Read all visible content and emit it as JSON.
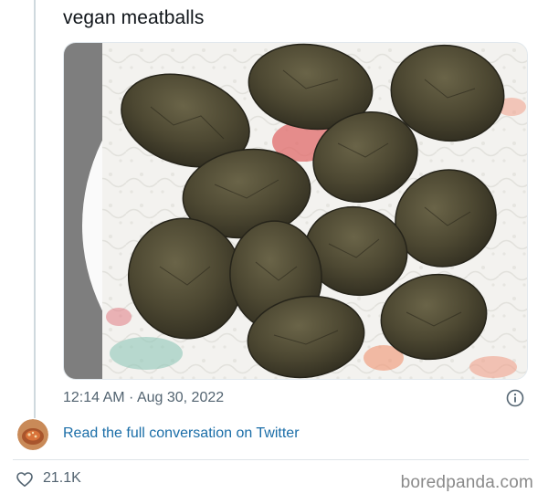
{
  "tweet": {
    "text": "vegan meatballs",
    "timestamp": "12:14 AM · Aug 30, 2022",
    "read_link": "Read the full conversation on Twitter",
    "likes": "21.1K"
  },
  "watermark": "boredpanda.com",
  "colors": {
    "link": "#1b6ea8",
    "meta_text": "#536471",
    "thread_line": "#cfd9de"
  },
  "icons": {
    "info": "info-icon",
    "heart": "heart-icon",
    "avatar": "avatar"
  }
}
